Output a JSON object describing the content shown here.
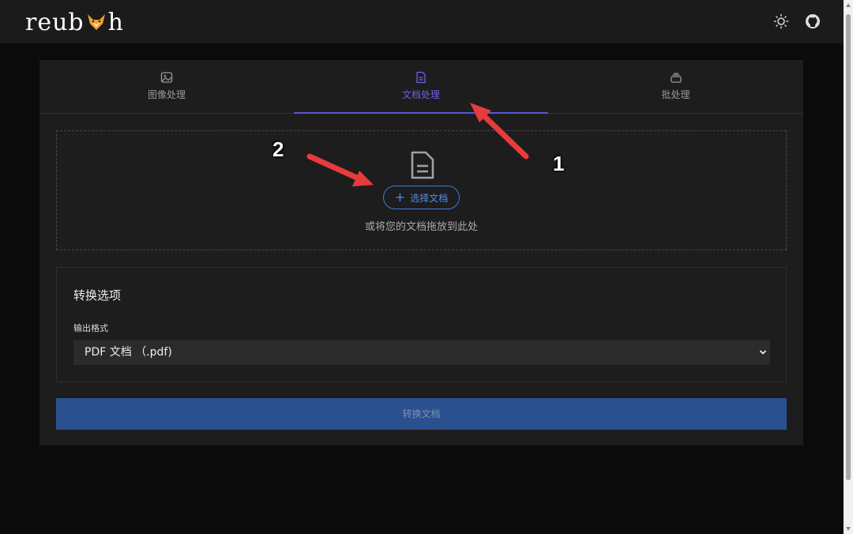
{
  "header": {
    "logo_text_before": "reub",
    "logo_text_after": "h",
    "logo_icon": "fox-icon",
    "theme_icon": "sun-icon",
    "repo_icon": "github-icon"
  },
  "tabs": [
    {
      "label": "图像处理",
      "icon": "image-icon",
      "active": false
    },
    {
      "label": "文档处理",
      "icon": "document-icon",
      "active": true
    },
    {
      "label": "批处理",
      "icon": "layers-icon",
      "active": false
    }
  ],
  "dropzone": {
    "icon": "document-icon",
    "button_label": "选择文档",
    "hint": "或将您的文档拖放到此处"
  },
  "options": {
    "title": "转换选项",
    "format_label": "输出格式",
    "format_value": "PDF 文档 （.pdf)"
  },
  "convert_label": "转换文档",
  "annotations": [
    "1",
    "2"
  ],
  "colors": {
    "accent": "#5b55d9",
    "primary_button": "#2b5090",
    "link_blue": "#4f8ef0",
    "annotation_red": "#e83b3b"
  }
}
